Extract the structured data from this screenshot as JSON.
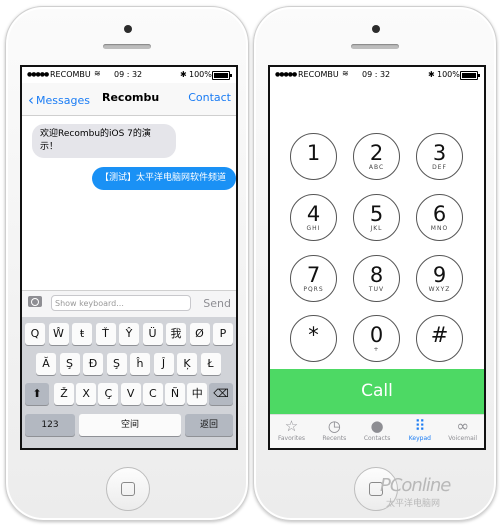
{
  "status": {
    "carrier": "RECOMBU",
    "wifi": "≋",
    "time": "09 : 32",
    "bluetooth": "✱",
    "battery": "100%"
  },
  "messages": {
    "back_label": "Messages",
    "title": "Recombu",
    "contact_label": "Contact",
    "incoming_text": "欢迎Recombu的iOS 7的演示！",
    "outgoing_text": "【测试】太平洋电脑网软件频道",
    "input_placeholder": "Show keyboard...",
    "send_label": "Send",
    "keyboard": {
      "row1": [
        "Q",
        "Ŵ",
        "ŧ",
        "Ť",
        "Ŷ",
        "Ü",
        "我",
        "Ø",
        "P"
      ],
      "row2": [
        "Ă",
        "Ş",
        "Đ",
        "Ş",
        "ĥ",
        "Ĵ",
        "Ķ",
        "Ł"
      ],
      "row3": [
        "Ž",
        "X",
        "Ç",
        "V",
        "Ⅽ",
        "Ñ",
        "中"
      ],
      "shift_icon": "shift-icon",
      "delete_icon": "delete-icon",
      "numbers_label": "123",
      "space_label": "空间",
      "return_label": "返回"
    }
  },
  "dialer": {
    "keys": [
      {
        "num": "1",
        "letters": ""
      },
      {
        "num": "2",
        "letters": "ABC"
      },
      {
        "num": "3",
        "letters": "DEF"
      },
      {
        "num": "4",
        "letters": "GHI"
      },
      {
        "num": "5",
        "letters": "JKL"
      },
      {
        "num": "6",
        "letters": "MNO"
      },
      {
        "num": "7",
        "letters": "PQRS"
      },
      {
        "num": "8",
        "letters": "TUV"
      },
      {
        "num": "9",
        "letters": "WXYZ"
      },
      {
        "num": "*",
        "letters": ""
      },
      {
        "num": "0",
        "letters": "+"
      },
      {
        "num": "#",
        "letters": ""
      }
    ],
    "call_label": "Call",
    "tabs": [
      {
        "label": "Favorites",
        "icon": "star-icon"
      },
      {
        "label": "Recents",
        "icon": "clock-icon"
      },
      {
        "label": "Contacts",
        "icon": "person-icon"
      },
      {
        "label": "Keypad",
        "icon": "keypad-icon"
      },
      {
        "label": "Voicemail",
        "icon": "voicemail-icon"
      }
    ],
    "active_tab": "Keypad"
  },
  "watermark": {
    "brand": "PConline",
    "sub": "太平洋电脑网"
  },
  "colors": {
    "ios_blue": "#1a7cf4",
    "bubble_blue": "#1a91f5",
    "call_green": "#4dd964"
  }
}
